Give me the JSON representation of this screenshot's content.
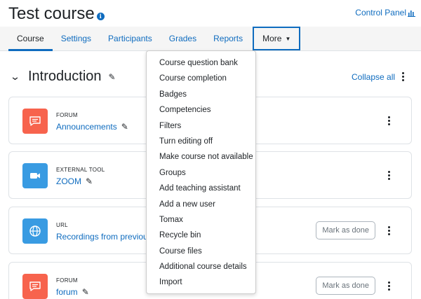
{
  "header": {
    "title": "Test course",
    "info_icon": "i",
    "control_panel": "Control Panel"
  },
  "tabs": [
    {
      "label": "Course",
      "active": true
    },
    {
      "label": "Settings"
    },
    {
      "label": "Participants"
    },
    {
      "label": "Grades"
    },
    {
      "label": "Reports"
    },
    {
      "label": "More"
    }
  ],
  "section": {
    "title": "Introduction",
    "collapse_all": "Collapse all"
  },
  "activities": [
    {
      "type": "FORUM",
      "name": "Announcements",
      "icon": "forum-icon",
      "color": "#f7634d",
      "editable": true,
      "mark_done": false
    },
    {
      "type": "EXTERNAL TOOL",
      "name": "ZOOM",
      "icon": "video-camera-icon",
      "color": "#399be2",
      "editable": true,
      "mark_done": false
    },
    {
      "type": "URL",
      "name": "Recordings from previous ye",
      "icon": "globe-icon",
      "color": "#399be2",
      "editable": false,
      "mark_done": true
    },
    {
      "type": "FORUM",
      "name": "forum",
      "icon": "forum-icon",
      "color": "#f7634d",
      "editable": true,
      "mark_done": true
    }
  ],
  "mark_as_done_label": "Mark as done",
  "more_menu": [
    "Course question bank",
    "Course completion",
    "Badges",
    "Competencies",
    "Filters",
    "Turn editing off",
    "Make course not available",
    "Groups",
    "Add teaching assistant",
    "Add a new user",
    "Tomax",
    "Recycle bin",
    "Course files",
    "Additional course details",
    "Import"
  ],
  "colors": {
    "accent": "#0f6cbf",
    "forum": "#f7634d",
    "tool": "#399be2"
  }
}
